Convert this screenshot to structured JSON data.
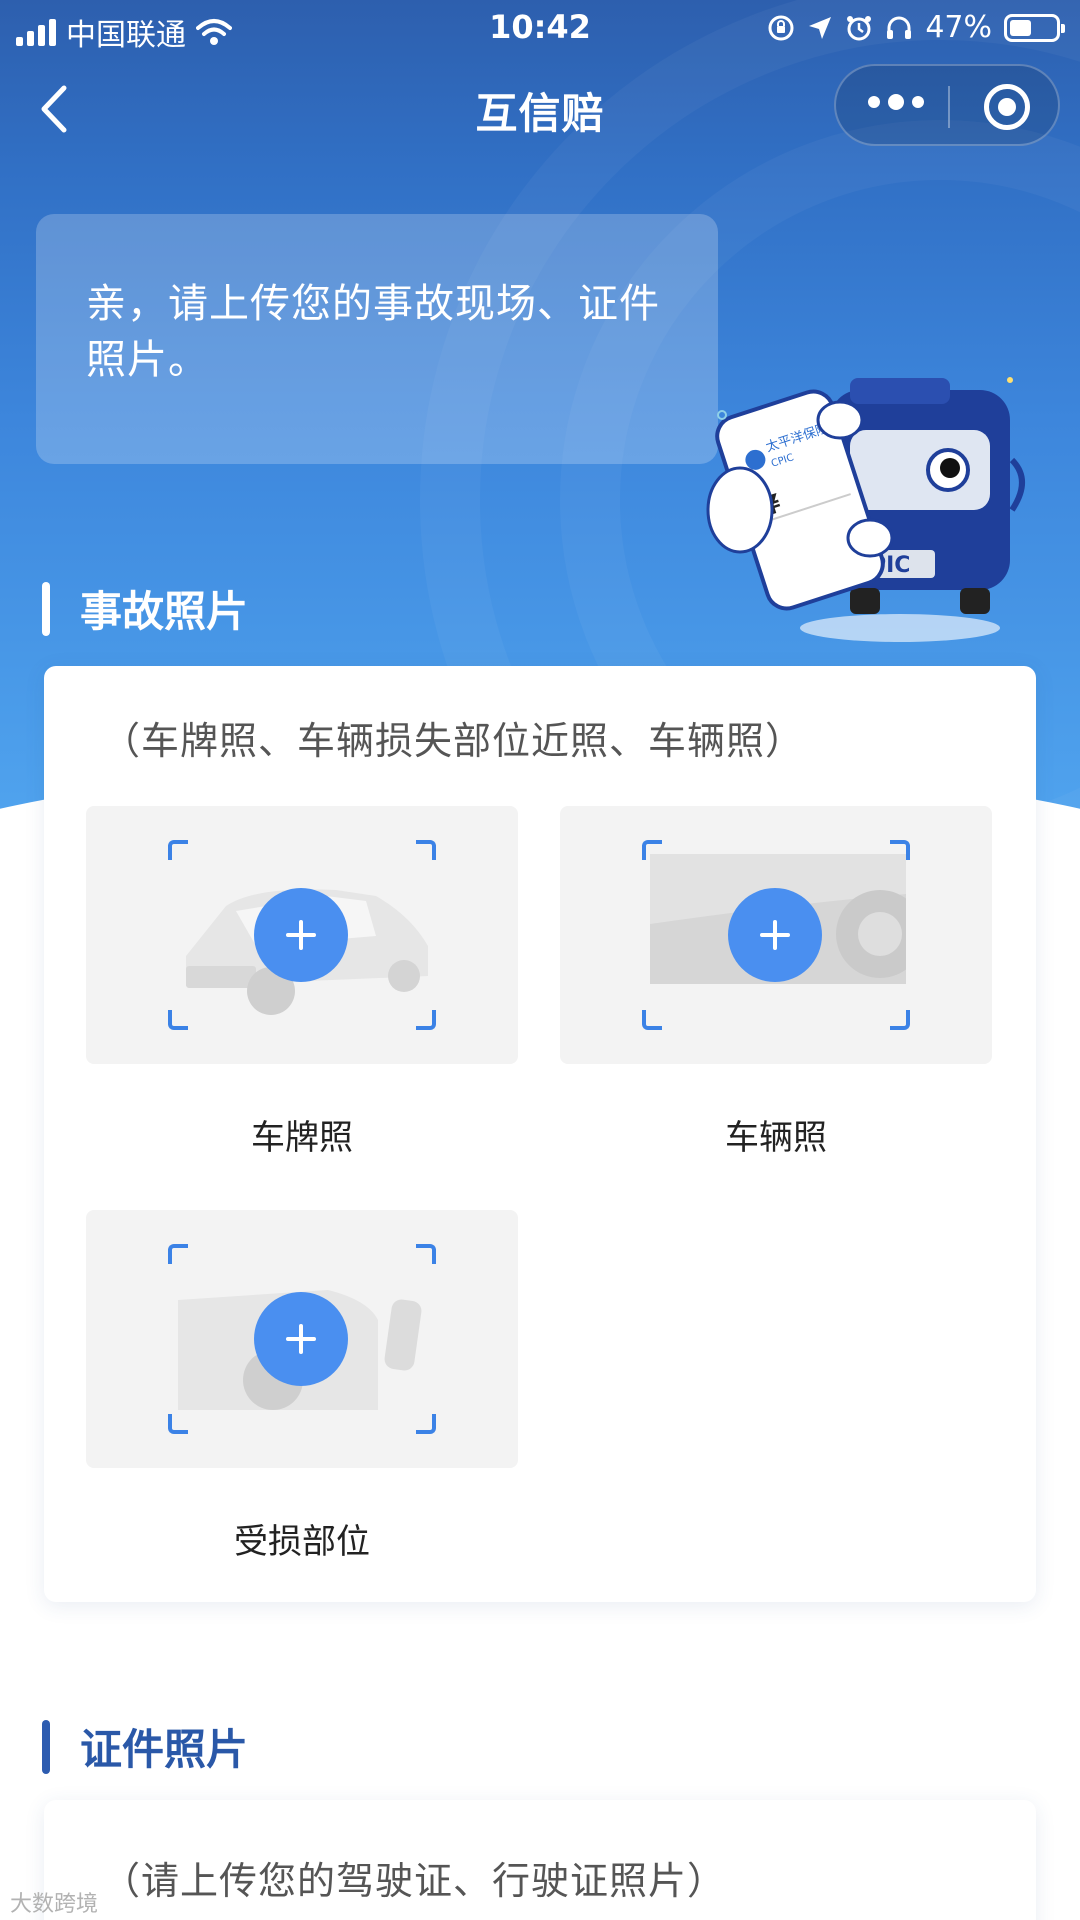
{
  "status_bar": {
    "carrier": "中国联通",
    "time": "10:42",
    "battery": "47%",
    "battery_level": 0.47
  },
  "nav": {
    "title": "互信赔"
  },
  "bubble": {
    "text": "亲，请上传您的事故现场、证件照片。"
  },
  "mascot": {
    "phone_brand": "太平洋保险",
    "phone_brand_sub": "CPIC",
    "currency": "¥",
    "plate": "PIC"
  },
  "accident_section": {
    "title": "事故照片",
    "hint": "（车牌照、车辆损失部位近照、车辆照）",
    "tiles": [
      {
        "label": "车牌照"
      },
      {
        "label": "车辆照"
      },
      {
        "label": "受损部位"
      }
    ]
  },
  "document_section": {
    "title": "证件照片",
    "hint": "（请上传您的驾驶证、行驶证照片）"
  },
  "watermark": "大数跨境",
  "colors": {
    "accent_blue": "#4a8ff0",
    "section_bar_accident": "#ffffff",
    "section_bar_document": "#2d5cb0",
    "section_title_document": "#2a58a8"
  }
}
